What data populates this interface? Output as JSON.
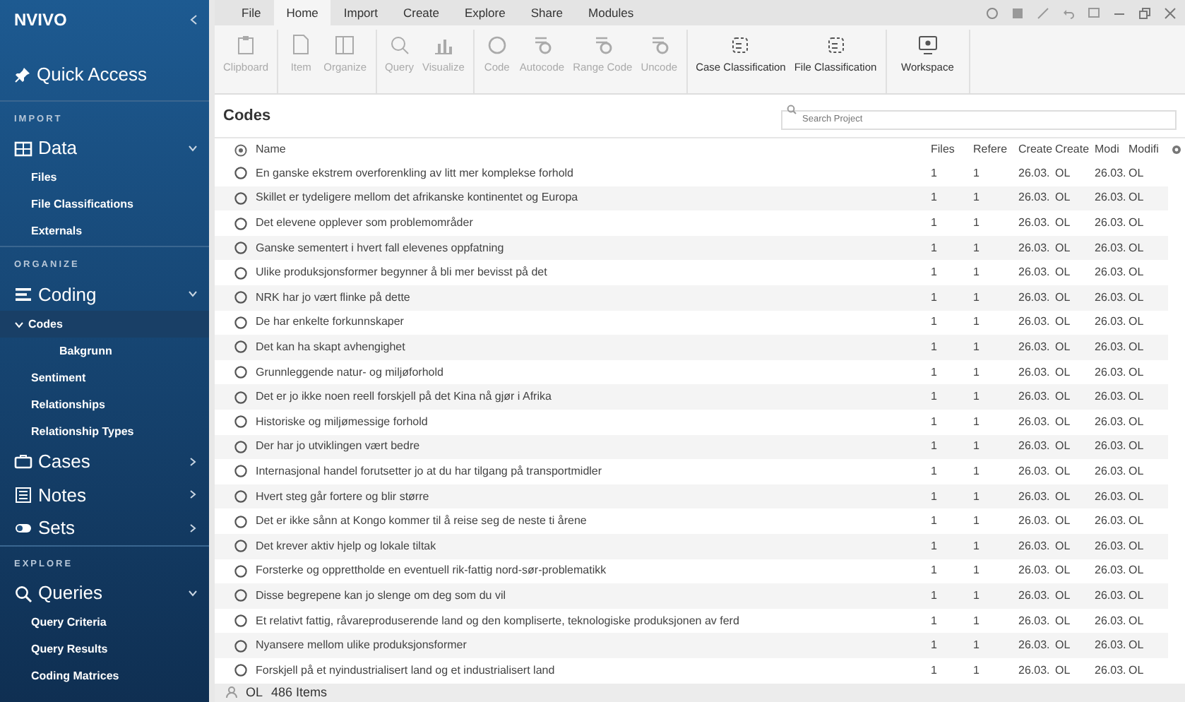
{
  "sidebar": {
    "logo": "NVIVO",
    "quick_access": "Quick Access",
    "sections": [
      {
        "heading": "IMPORT",
        "groups": [
          {
            "label": "Data",
            "expanded": true,
            "children": [
              {
                "label": "Files",
                "selected": false
              },
              {
                "label": "File Classifications",
                "selected": false
              },
              {
                "label": "Externals",
                "selected": false
              }
            ]
          }
        ]
      },
      {
        "heading": "ORGANIZE",
        "groups": [
          {
            "label": "Coding",
            "expanded": true,
            "children": [
              {
                "label": "Codes",
                "selected": true,
                "expanded": true,
                "children": [
                  {
                    "label": "Bakgrunn",
                    "selected": false
                  }
                ]
              },
              {
                "label": "Sentiment",
                "selected": false
              },
              {
                "label": "Relationships",
                "selected": false
              },
              {
                "label": "Relationship Types",
                "selected": false
              }
            ]
          },
          {
            "label": "Cases",
            "expanded": false
          },
          {
            "label": "Notes",
            "expanded": false
          },
          {
            "label": "Sets",
            "expanded": false
          }
        ]
      },
      {
        "heading": "EXPLORE",
        "groups": [
          {
            "label": "Queries",
            "expanded": true,
            "children": [
              {
                "label": "Query Criteria",
                "selected": false
              },
              {
                "label": "Query Results",
                "selected": false
              },
              {
                "label": "Coding Matrices",
                "selected": false
              }
            ]
          }
        ]
      }
    ]
  },
  "menu_tabs": [
    {
      "label": "File",
      "selected": false
    },
    {
      "label": "Home",
      "selected": true
    },
    {
      "label": "Import",
      "selected": false
    },
    {
      "label": "Create",
      "selected": false
    },
    {
      "label": "Explore",
      "selected": false
    },
    {
      "label": "Share",
      "selected": false
    },
    {
      "label": "Modules",
      "selected": false
    }
  ],
  "ribbon": [
    [
      {
        "label": "Clipboard",
        "disabled": true
      }
    ],
    [
      {
        "label": "Item",
        "disabled": true
      },
      {
        "label": "Organize",
        "disabled": true
      }
    ],
    [
      {
        "label": "Query",
        "disabled": true
      },
      {
        "label": "Visualize",
        "disabled": true
      }
    ],
    [
      {
        "label": "Code",
        "disabled": true
      },
      {
        "label": "Autocode",
        "disabled": true
      },
      {
        "label": "Range Code",
        "disabled": true
      },
      {
        "label": "Uncode",
        "disabled": true
      }
    ],
    [
      {
        "label": "Case Classification",
        "disabled": false
      },
      {
        "label": "File Classification",
        "disabled": false
      }
    ],
    [
      {
        "label": "Workspace",
        "disabled": false
      }
    ]
  ],
  "list": {
    "title": "Codes",
    "search_placeholder": "Search Project",
    "columns": [
      "Name",
      "Files",
      "Refere",
      "Create",
      "Create",
      "Modi",
      "Modifi"
    ],
    "rows": [
      [
        "En ganske ekstrem overforenkling av litt mer komplekse forhold",
        "1",
        "1",
        "26.03.",
        "OL",
        "26.03.",
        "OL"
      ],
      [
        "Skillet er tydeligere mellom det afrikanske kontinentet og Europa",
        "1",
        "1",
        "26.03.",
        "OL",
        "26.03.",
        "OL"
      ],
      [
        "Det elevene opplever som problemområder",
        "1",
        "1",
        "26.03.",
        "OL",
        "26.03.",
        "OL"
      ],
      [
        "Ganske sementert i hvert fall elevenes oppfatning",
        "1",
        "1",
        "26.03.",
        "OL",
        "26.03.",
        "OL"
      ],
      [
        "Ulike produksjonsformer begynner å bli mer bevisst på det",
        "1",
        "1",
        "26.03.",
        "OL",
        "26.03.",
        "OL"
      ],
      [
        "NRK har jo vært flinke på dette",
        "1",
        "1",
        "26.03.",
        "OL",
        "26.03.",
        "OL"
      ],
      [
        "De har enkelte forkunnskaper",
        "1",
        "1",
        "26.03.",
        "OL",
        "26.03.",
        "OL"
      ],
      [
        "Det kan ha skapt avhengighet",
        "1",
        "1",
        "26.03.",
        "OL",
        "26.03.",
        "OL"
      ],
      [
        "Grunnleggende natur- og miljøforhold",
        "1",
        "1",
        "26.03.",
        "OL",
        "26.03.",
        "OL"
      ],
      [
        "Det er jo ikke noen reell forskjell på det Kina nå gjør i Afrika",
        "1",
        "1",
        "26.03.",
        "OL",
        "26.03.",
        "OL"
      ],
      [
        "Historiske og miljømessige forhold",
        "1",
        "1",
        "26.03.",
        "OL",
        "26.03.",
        "OL"
      ],
      [
        "Der har jo utviklingen vært bedre",
        "1",
        "1",
        "26.03.",
        "OL",
        "26.03.",
        "OL"
      ],
      [
        "Internasjonal handel forutsetter jo at du har tilgang på transportmidler",
        "1",
        "1",
        "26.03.",
        "OL",
        "26.03.",
        "OL"
      ],
      [
        "Hvert steg går fortere og blir større",
        "1",
        "1",
        "26.03.",
        "OL",
        "26.03.",
        "OL"
      ],
      [
        "Det er ikke sånn at Kongo kommer til å reise seg de neste ti årene",
        "1",
        "1",
        "26.03.",
        "OL",
        "26.03.",
        "OL"
      ],
      [
        "Det krever aktiv hjelp og lokale tiltak",
        "1",
        "1",
        "26.03.",
        "OL",
        "26.03.",
        "OL"
      ],
      [
        "Forsterke og opprettholde en eventuell rik-fattig nord-sør-problematikk",
        "1",
        "1",
        "26.03.",
        "OL",
        "26.03.",
        "OL"
      ],
      [
        "Disse begrepene kan jo slenge om deg som du vil",
        "1",
        "1",
        "26.03.",
        "OL",
        "26.03.",
        "OL"
      ],
      [
        "Et relativt fattig, råvareproduserende land og den kompliserte, teknologiske produksjonen av ferd",
        "1",
        "1",
        "26.03.",
        "OL",
        "26.03.",
        "OL"
      ],
      [
        "Nyansere mellom ulike produksjonsformer",
        "1",
        "1",
        "26.03.",
        "OL",
        "26.03.",
        "OL"
      ],
      [
        "Forskjell på et nyindustrialisert land og et industrialisert land",
        "1",
        "1",
        "26.03.",
        "OL",
        "26.03.",
        "OL"
      ]
    ]
  },
  "status_bar": {
    "user": "OL",
    "count": "486 Items"
  }
}
